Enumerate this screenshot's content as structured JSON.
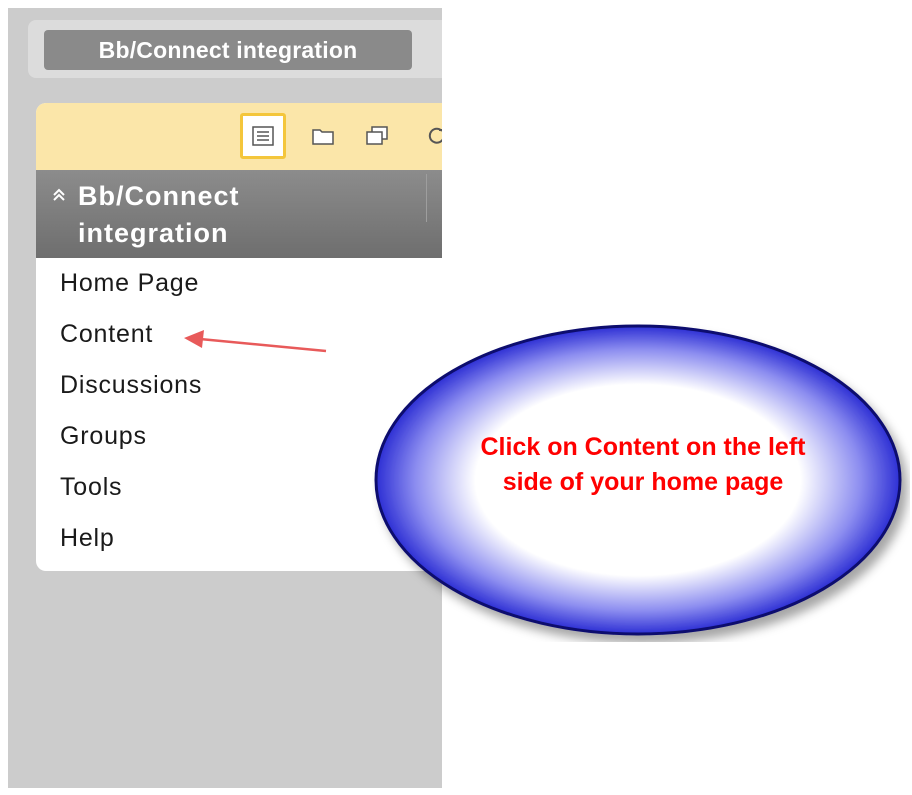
{
  "course_tab": {
    "label": "Bb/Connect integration"
  },
  "toolbar": {
    "icons": [
      "list-view-icon",
      "folder-icon",
      "windows-icon",
      "refresh-icon"
    ]
  },
  "course_menu": {
    "title": "Bb/Connect integration",
    "items": [
      "Home Page",
      "Content",
      "Discussions",
      "Groups",
      "Tools",
      "Help"
    ]
  },
  "callout": {
    "text": "Click on Content on the left side of your home page",
    "text_color": "#ff0000",
    "fill_color": "#2d2fd4",
    "border_color": "#0c0c6e"
  },
  "colors": {
    "toolbar_bg": "#fbe6a9",
    "header_bg": "#7a7a7a",
    "panel_bg": "#cccccc",
    "arrow": "#e85a5a"
  }
}
